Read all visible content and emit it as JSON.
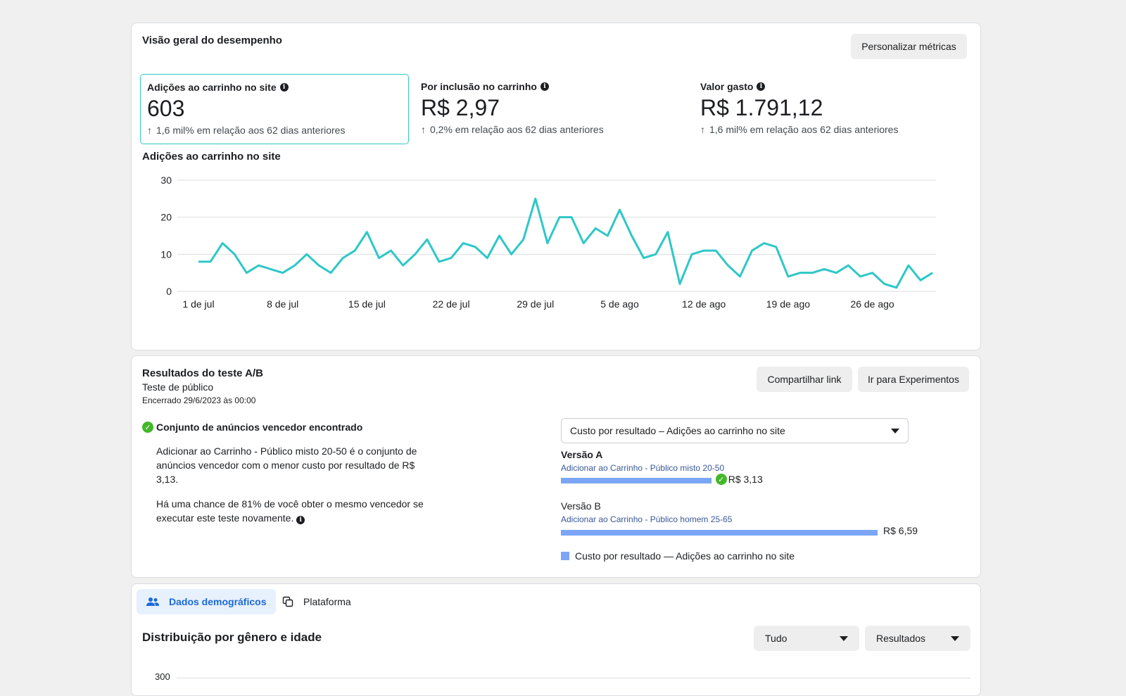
{
  "performance": {
    "title": "Visão geral do desempenho",
    "customize_button": "Personalizar métricas",
    "metrics": [
      {
        "label": "Adições ao carrinho no site",
        "value": "603",
        "delta": "1,6 mil% em relação aos 62 dias anteriores"
      },
      {
        "label": "Por inclusão no carrinho",
        "value": "R$ 2,97",
        "delta": "0,2% em relação aos 62 dias anteriores"
      },
      {
        "label": "Valor gasto",
        "value": "R$ 1.791,12",
        "delta": "1,6 mil% em relação aos 62 dias anteriores"
      }
    ],
    "info_glyph": "i",
    "arrow_glyph": "↑"
  },
  "chart_data": {
    "type": "line",
    "title": "Adições ao carrinho no site",
    "x_tick_labels": [
      "1 de jul",
      "8 de jul",
      "15 de jul",
      "22 de jul",
      "29 de jul",
      "5 de ago",
      "12 de ago",
      "19 de ago",
      "26 de ago"
    ],
    "y_tick_labels": [
      "0",
      "10",
      "20",
      "30"
    ],
    "ylim": [
      0,
      30
    ],
    "grid": true,
    "color": "#2ec7c7",
    "series": [
      {
        "values": [
          8,
          8,
          13,
          10,
          5,
          7,
          6,
          5,
          7,
          10,
          7,
          5,
          9,
          11,
          16,
          9,
          11,
          7,
          10,
          14,
          8,
          9,
          13,
          12,
          9,
          15,
          10,
          14,
          25,
          13,
          20,
          20,
          13,
          17,
          15,
          22,
          15,
          9,
          10,
          16,
          2,
          10,
          11,
          11,
          7,
          4,
          11,
          13,
          12,
          4,
          5,
          5,
          6,
          5,
          7,
          4,
          5,
          2,
          1,
          7,
          3,
          5
        ]
      }
    ]
  },
  "ab_test": {
    "title": "Resultados do teste A/B",
    "subtitle": "Teste de público",
    "ended": "Encerrado 29/6/2023 às 00:00",
    "share_button": "Compartilhar link",
    "experiments_button": "Ir para Experimentos",
    "winner_heading": "Conjunto de anúncios vencedor encontrado",
    "winner_text_1": "Adicionar ao Carrinho - Público misto 20-50 é o conjunto de anúncios vencedor com o menor custo por resultado de R$ 3,13.",
    "winner_text_2": "Há uma chance de 81% de você obter o mesmo vencedor se executar este teste novamente.",
    "select_value": "Custo por resultado – Adições ao carrinho no site",
    "versions": [
      {
        "name": "Versão A",
        "ad_set": "Adicionar ao Carrinho - Público misto 20-50",
        "value": "R$ 3,13",
        "amount": 3.13,
        "winner": true
      },
      {
        "name": "Versão B",
        "ad_set": "Adicionar ao Carrinho - Público homem 25-65",
        "value": "R$ 6,59",
        "amount": 6.59,
        "winner": false
      }
    ],
    "legend": "Custo por resultado — Adições ao carrinho no site",
    "check_glyph": "✓",
    "bar_color": "#7ba6f5"
  },
  "breakdown": {
    "tabs": [
      {
        "label": "Dados demográficos",
        "active": true
      },
      {
        "label": "Plataforma",
        "active": false
      }
    ],
    "title": "Distribuição por gênero e idade",
    "filter_all": "Tudo",
    "filter_results": "Resultados",
    "y_top_tick": "300"
  }
}
